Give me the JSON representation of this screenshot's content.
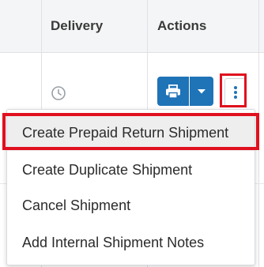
{
  "table": {
    "headers": {
      "delivery": "Delivery",
      "actions": "Actions"
    }
  },
  "row": {
    "delivery_icon": "clock-icon",
    "print_icon": "printer-icon",
    "caret_icon": "caret-down-icon",
    "more_icon": "vertical-dots-icon"
  },
  "menu": {
    "items": [
      {
        "label": "Create Prepaid Return Shipment",
        "highlighted": true
      },
      {
        "label": "Create Duplicate Shipment"
      },
      {
        "label": "Cancel Shipment"
      },
      {
        "label": "Add Internal Shipment Notes"
      }
    ]
  },
  "colors": {
    "primary_button": "#1f73b7",
    "highlight_outline": "#e0101e",
    "header_bg": "#f4f5f6"
  }
}
